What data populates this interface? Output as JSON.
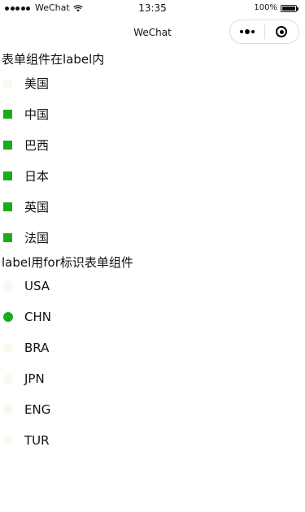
{
  "status_bar": {
    "carrier": "WeChat",
    "time": "13:35",
    "battery_percent": "100%",
    "battery_level": 1.0
  },
  "nav": {
    "title": "WeChat"
  },
  "section1": {
    "title": "表单组件在label内",
    "items": [
      {
        "label": "美国",
        "checked": false
      },
      {
        "label": "中国",
        "checked": true
      },
      {
        "label": "巴西",
        "checked": true
      },
      {
        "label": "日本",
        "checked": true
      },
      {
        "label": "英国",
        "checked": true
      },
      {
        "label": "法国",
        "checked": true
      }
    ]
  },
  "section2": {
    "title": "label用for标识表单组件",
    "items": [
      {
        "label": "USA",
        "selected": false
      },
      {
        "label": "CHN",
        "selected": true
      },
      {
        "label": "BRA",
        "selected": false
      },
      {
        "label": "JPN",
        "selected": false
      },
      {
        "label": "ENG",
        "selected": false
      },
      {
        "label": "TUR",
        "selected": false
      }
    ]
  },
  "colors": {
    "accent": "#1aad19",
    "unchecked": "#f6fbef"
  }
}
